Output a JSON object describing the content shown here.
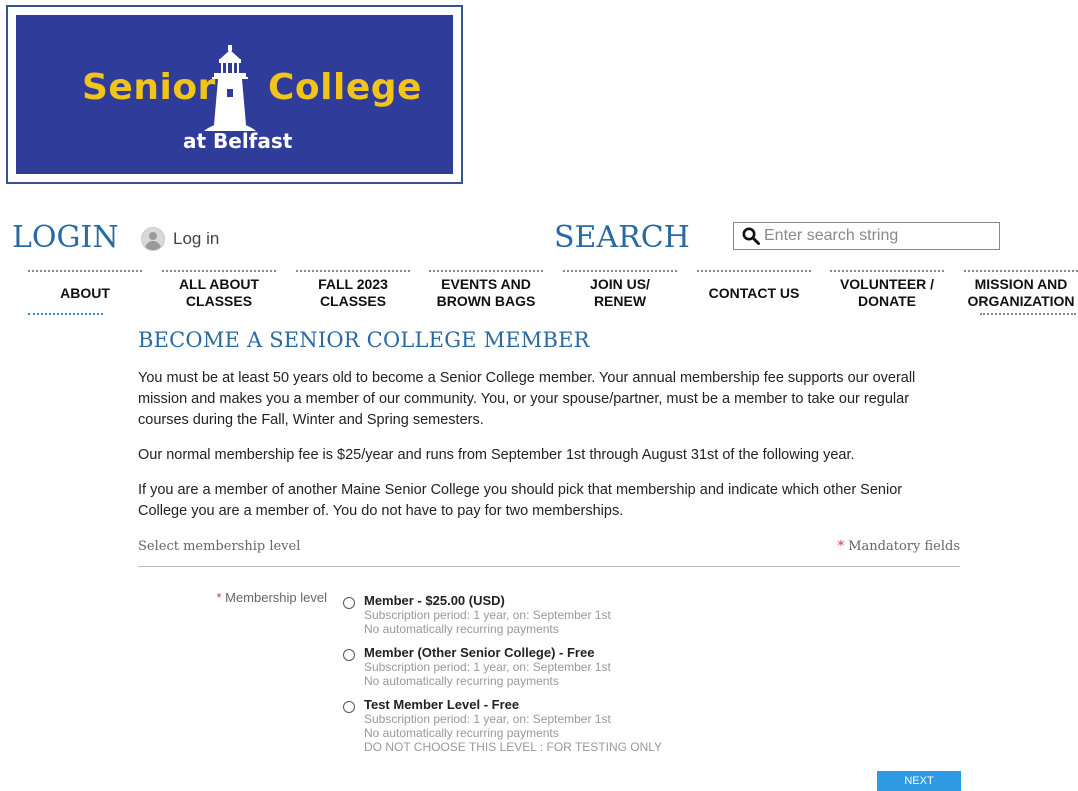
{
  "logo": {
    "word_left": "Senior",
    "word_right": "College",
    "sub": "at Belfast"
  },
  "login": {
    "title": "LOGIN",
    "link_label": "Log in"
  },
  "search": {
    "title": "SEARCH",
    "placeholder": "Enter search string"
  },
  "nav": {
    "items": [
      {
        "line1": "ABOUT",
        "line2": ""
      },
      {
        "line1": "ALL ABOUT",
        "line2": "CLASSES"
      },
      {
        "line1": "FALL 2023",
        "line2": "CLASSES"
      },
      {
        "line1": "EVENTS AND",
        "line2": "BROWN BAGS"
      },
      {
        "line1": "JOIN US/",
        "line2": "RENEW"
      },
      {
        "line1": "CONTACT US",
        "line2": ""
      },
      {
        "line1": "VOLUNTEER /",
        "line2": "DONATE"
      },
      {
        "line1": "MISSION AND",
        "line2": "ORGANIZATION"
      }
    ]
  },
  "page": {
    "heading": "BECOME A SENIOR COLLEGE MEMBER",
    "paragraphs": [
      "You must be at least 50 years old to become a Senior College member. Your annual membership fee supports our overall mission and makes you a member of our community. You, or your spouse/partner, must be a member to take our regular courses during the Fall, Winter and Spring semesters.",
      "Our normal membership fee is $25/year and runs from September 1st through August 31st of the following year.",
      "If you are a member of another Maine Senior College you should pick that membership and indicate which other Senior College you are a member of. You do not have to pay for two memberships."
    ]
  },
  "form": {
    "section_label": "Select membership level",
    "mandatory_star": "*",
    "mandatory_label": "Mandatory fields",
    "field_star": "*",
    "field_label": "Membership level",
    "options": [
      {
        "title": "Member - $25.00 (USD)",
        "lines": [
          "Subscription period: 1 year, on: September 1st",
          "No automatically recurring payments",
          ""
        ]
      },
      {
        "title": "Member (Other Senior College) - Free",
        "lines": [
          "Subscription period: 1 year, on: September 1st",
          "No automatically recurring payments",
          ""
        ]
      },
      {
        "title": "Test Member Level - Free",
        "lines": [
          "Subscription period: 1 year, on: September 1st",
          "No automatically recurring payments",
          "DO NOT CHOOSE THIS LEVEL : FOR TESTING ONLY"
        ]
      }
    ],
    "next_label": "NEXT"
  },
  "colors": {
    "logo_bg": "#2f3c9a",
    "logo_text": "#f0c419",
    "heading_blue": "#2a6aa3",
    "button_blue": "#2e9ae3",
    "required_red": "#d9363e"
  },
  "icons": [
    "lighthouse-icon",
    "user-icon",
    "search-icon"
  ]
}
